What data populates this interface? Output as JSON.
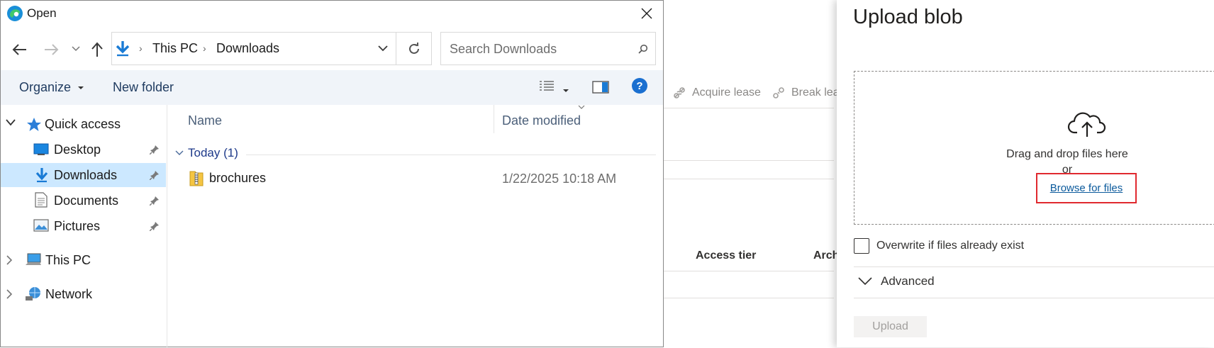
{
  "dialog": {
    "title": "Open",
    "address": {
      "segments": [
        "This PC",
        "Downloads"
      ]
    },
    "search": {
      "placeholder": "Search Downloads"
    },
    "commands": {
      "organize": "Organize",
      "new_folder": "New folder"
    },
    "nav": {
      "quick_access": "Quick access",
      "items": [
        {
          "label": "Desktop",
          "icon": "desktop-icon",
          "pinned": true
        },
        {
          "label": "Downloads",
          "icon": "download-arrow-icon",
          "pinned": true,
          "selected": true
        },
        {
          "label": "Documents",
          "icon": "documents-icon",
          "pinned": true
        },
        {
          "label": "Pictures",
          "icon": "pictures-icon",
          "pinned": true
        }
      ],
      "this_pc": "This PC",
      "network": "Network"
    },
    "columns": {
      "name": "Name",
      "date_modified": "Date modified"
    },
    "group": {
      "label": "Today (1)"
    },
    "files": [
      {
        "name": "brochures",
        "date": "1/22/2025 10:18 AM",
        "icon": "zip-folder-icon"
      }
    ]
  },
  "background": {
    "commands": [
      "Acquire lease",
      "Break lea"
    ],
    "columns": [
      "Access tier",
      "Arch"
    ]
  },
  "upload_panel": {
    "title": "Upload blob",
    "drag_text": "Drag and drop files here",
    "or_text": "or",
    "browse_link": "Browse for files",
    "overwrite_label": "Overwrite if files already exist",
    "overwrite_checked": false,
    "advanced_label": "Advanced",
    "upload_button": "Upload",
    "highlight_color": "#e0292f"
  },
  "colors": {
    "selection": "#cce8ff",
    "link": "#0b5a9c",
    "accent": "#0078d4"
  }
}
